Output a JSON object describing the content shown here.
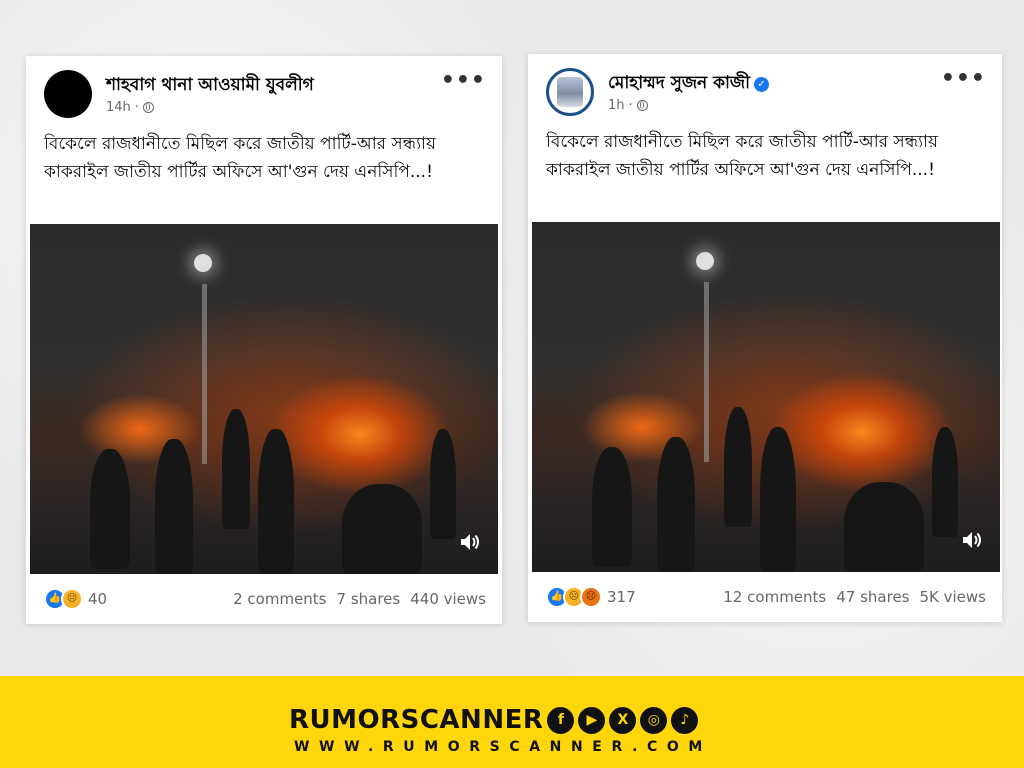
{
  "posts": [
    {
      "page_name": "শাহবাগ থানা আওয়ামী যুবলীগ",
      "time": "14h",
      "verified": false,
      "more_icon": "more-dots-icon",
      "text": "বিকেলে রাজধানীতে মিছিল করে জাতীয় পার্টি-আর সন্ধ্যায় কাকরাইল জাতীয় পার্টির অফিসে আ'গুন দেয় এনসিপি...!",
      "reactions": [
        "like",
        "sad"
      ],
      "reaction_count": "40",
      "comments": "2 comments",
      "shares": "7 shares",
      "views": "440 views"
    },
    {
      "page_name": "মোহাম্মদ সুজন কাজী",
      "time": "1h",
      "verified": true,
      "more_icon": "more-dots-icon",
      "text": "বিকেলে রাজধানীতে মিছিল করে জাতীয় পার্টি-আর সন্ধ্যায় কাকরাইল জাতীয় পার্টির অফিসে আ'গুন দেয় এনসিপি...!",
      "reactions": [
        "like",
        "sad",
        "angry"
      ],
      "reaction_count": "317",
      "comments": "12 comments",
      "shares": "47 shares",
      "views": "5K views"
    }
  ],
  "banner": {
    "brand": "RUMORSCANNER",
    "url": "WWW.RUMORSCANNER.COM",
    "social_icons": [
      "facebook-icon",
      "youtube-icon",
      "x-icon",
      "instagram-icon",
      "tiktok-icon"
    ],
    "background_color": "#ffd60a"
  },
  "colors": {
    "facebook_blue": "#1877f2",
    "meta_gray": "#65676b"
  }
}
